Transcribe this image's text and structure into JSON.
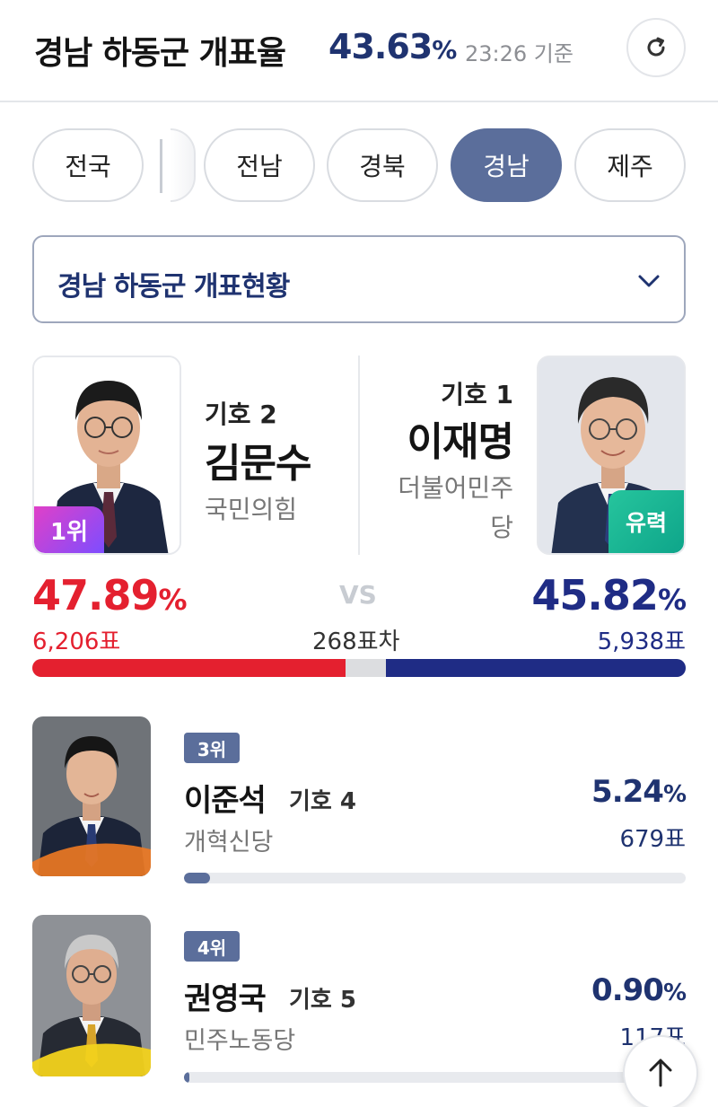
{
  "header": {
    "title": "경남 하동군 개표율",
    "rate_value": "43.63",
    "rate_unit": "%",
    "time": "23:26 기준",
    "refresh_icon": "refresh-icon"
  },
  "tabs": [
    {
      "label": "전국",
      "active": false
    },
    {
      "label": "전남",
      "active": false
    },
    {
      "label": "경북",
      "active": false
    },
    {
      "label": "경남",
      "active": true
    },
    {
      "label": "제주",
      "active": false
    }
  ],
  "dropdown": {
    "label": "경남 하동군 개표현황",
    "icon": "chevron-down-icon"
  },
  "matchup": {
    "left": {
      "number_label": "기호 2",
      "name": "김문수",
      "party": "국민의힘",
      "badge": "1위",
      "pct": "47.89",
      "pct_unit": "%",
      "votes": "6,206표",
      "share": 47.89,
      "color": "#e4202f"
    },
    "right": {
      "number_label": "기호 1",
      "name": "이재명",
      "party_line1": "더불어민주",
      "party_line2": "당",
      "badge": "유력",
      "pct": "45.82",
      "pct_unit": "%",
      "votes": "5,938표",
      "share": 45.82,
      "color": "#1f2c85"
    },
    "vs": "VS",
    "margin": "268표차"
  },
  "others": [
    {
      "rank": "3위",
      "name": "이준석",
      "number_label": "기호 4",
      "party": "개혁신당",
      "pct": "5.24",
      "pct_unit": "%",
      "votes": "679표",
      "share": 5.24,
      "accent": "#f07a22"
    },
    {
      "rank": "4위",
      "name": "권영국",
      "number_label": "기호 5",
      "party": "민주노동당",
      "pct": "0.90",
      "pct_unit": "%",
      "votes": "117표",
      "share": 0.9,
      "accent": "#f2d21c"
    }
  ],
  "scroll_top_icon": "arrow-up-icon"
}
